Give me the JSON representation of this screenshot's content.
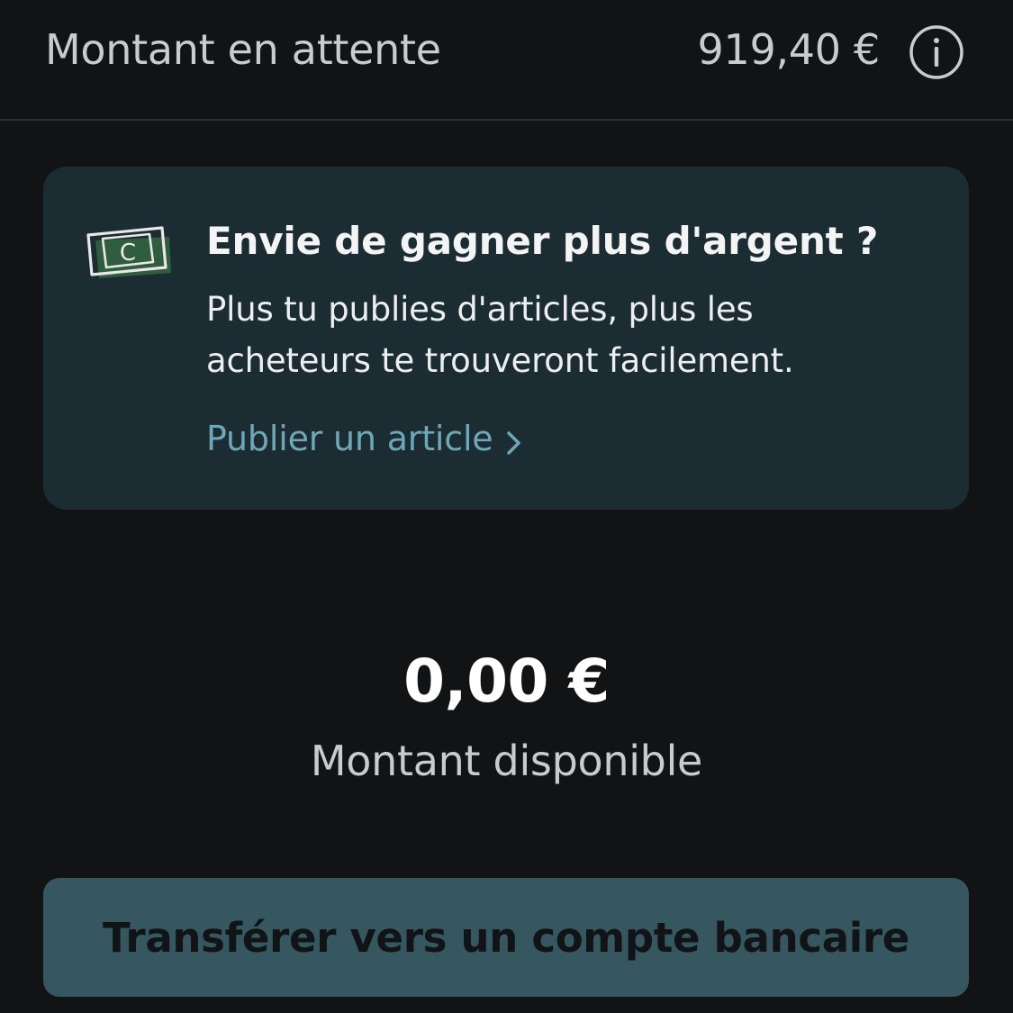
{
  "pending": {
    "label": "Montant en attente",
    "amount": "919,40 €",
    "info_icon": "info-circle-icon"
  },
  "promo": {
    "icon": "money-bill-icon",
    "title": "Envie de gagner plus d'argent ?",
    "text": "Plus tu publies d'articles, plus les acheteurs te trouveront facilement.",
    "link_label": "Publier un article",
    "link_icon": "chevron-right-icon",
    "bill_letter": "C"
  },
  "available": {
    "amount": "0,00 €",
    "label": "Montant disponible"
  },
  "transfer_button": {
    "label": "Transférer vers un compte bancaire"
  },
  "colors": {
    "background": "#121315",
    "card": "#1c2c33",
    "link": "#6ea8b8",
    "button": "#36575f",
    "bill_green": "#2f5d3e"
  }
}
